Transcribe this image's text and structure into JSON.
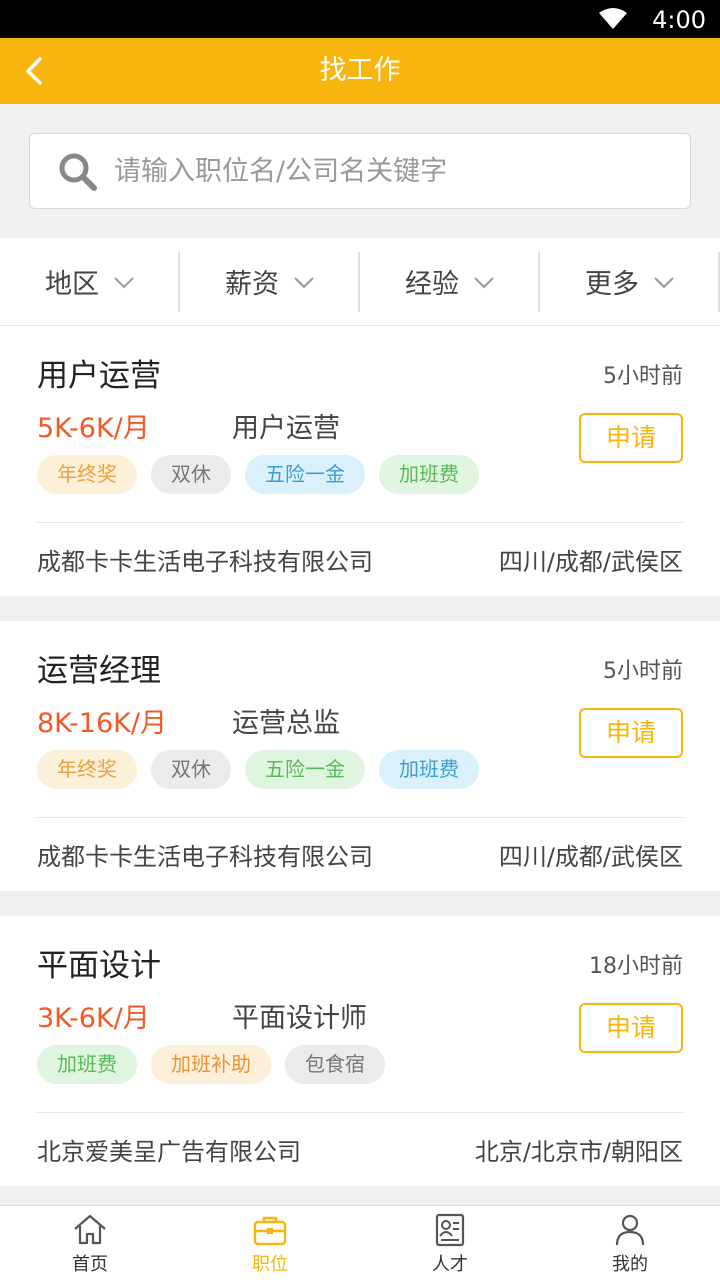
{
  "status_bar": {
    "time": "4:00"
  },
  "header": {
    "title": "找工作"
  },
  "search": {
    "placeholder": "请输入职位名/公司名关键字",
    "value": ""
  },
  "filters": [
    {
      "label": "地区",
      "icon": "chevron-down-icon"
    },
    {
      "label": "薪资",
      "icon": "chevron-down-icon"
    },
    {
      "label": "经验",
      "icon": "chevron-down-icon"
    },
    {
      "label": "更多",
      "icon": "chevron-down-icon"
    }
  ],
  "jobs": [
    {
      "title": "用户运营",
      "posted": "5小时前",
      "salary": "5K-6K/月",
      "position": "用户运营",
      "tags": [
        {
          "text": "年终奖",
          "color": "yellow"
        },
        {
          "text": "双休",
          "color": "gray"
        },
        {
          "text": "五险一金",
          "color": "blue"
        },
        {
          "text": "加班费",
          "color": "green"
        }
      ],
      "apply_label": "申请",
      "company": "成都卡卡生活电子科技有限公司",
      "location": "四川/成都/武侯区"
    },
    {
      "title": "运营经理",
      "posted": "5小时前",
      "salary": "8K-16K/月",
      "position": "运营总监",
      "tags": [
        {
          "text": "年终奖",
          "color": "yellow"
        },
        {
          "text": "双休",
          "color": "gray"
        },
        {
          "text": "五险一金",
          "color": "green"
        },
        {
          "text": "加班费",
          "color": "blue"
        }
      ],
      "apply_label": "申请",
      "company": "成都卡卡生活电子科技有限公司",
      "location": "四川/成都/武侯区"
    },
    {
      "title": "平面设计",
      "posted": "18小时前",
      "salary": "3K-6K/月",
      "position": "平面设计师",
      "tags": [
        {
          "text": "加班费",
          "color": "green"
        },
        {
          "text": "加班补助",
          "color": "orange"
        },
        {
          "text": "包食宿",
          "color": "gray"
        }
      ],
      "apply_label": "申请",
      "company": "北京爱美呈广告有限公司",
      "location": "北京/北京市/朝阳区"
    }
  ],
  "tabbar": [
    {
      "label": "首页",
      "icon": "home-icon",
      "active": false
    },
    {
      "label": "职位",
      "icon": "briefcase-icon",
      "active": true
    },
    {
      "label": "人才",
      "icon": "resume-icon",
      "active": false
    },
    {
      "label": "我的",
      "icon": "user-icon",
      "active": false
    }
  ],
  "colors": {
    "accent": "#f8b50d",
    "salary": "#f15a24",
    "background": "#f0f0f2"
  }
}
